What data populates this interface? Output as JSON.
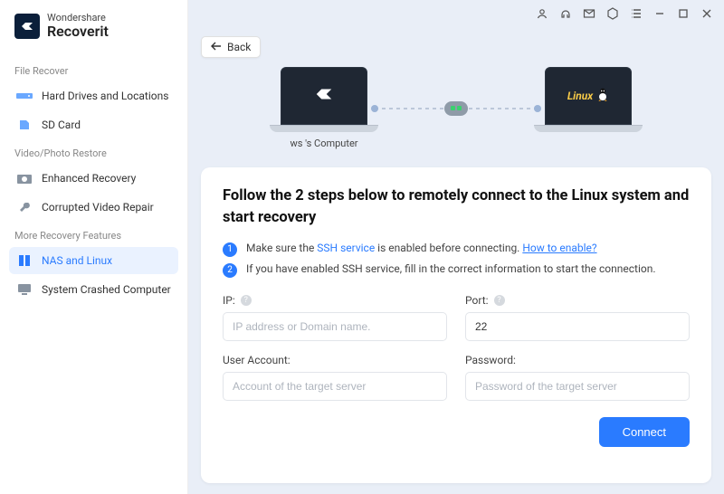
{
  "brand": {
    "line1": "Wondershare",
    "line2": "Recoverit"
  },
  "sidebar": {
    "section1": "File Recover",
    "items1": [
      {
        "label": "Hard Drives and Locations"
      },
      {
        "label": "SD Card"
      }
    ],
    "section2": "Video/Photo Restore",
    "items2": [
      {
        "label": "Enhanced Recovery"
      },
      {
        "label": "Corrupted Video Repair"
      }
    ],
    "section3": "More Recovery Features",
    "items3": [
      {
        "label": "NAS and Linux"
      },
      {
        "label": "System Crashed Computer"
      }
    ]
  },
  "back_label": "Back",
  "diagram": {
    "left_label": "ws 's Computer",
    "right_os": "Linux"
  },
  "panel": {
    "heading": "Follow the 2 steps below to remotely connect to the Linux system and start recovery",
    "step1_pre": "Make sure the ",
    "step1_link1": "SSH service",
    "step1_mid": " is enabled before connecting. ",
    "step1_link2": "How to enable?",
    "step2": "If you have enabled SSH service, fill in the correct information to start the connection.",
    "form": {
      "ip_label": "IP:",
      "ip_placeholder": "IP address or Domain name.",
      "ip_value": "",
      "port_label": "Port:",
      "port_value": "22",
      "user_label": "User Account:",
      "user_placeholder": "Account of the target server",
      "user_value": "",
      "password_label": "Password:",
      "password_placeholder": "Password of the target server",
      "password_value": ""
    },
    "connect_label": "Connect"
  }
}
